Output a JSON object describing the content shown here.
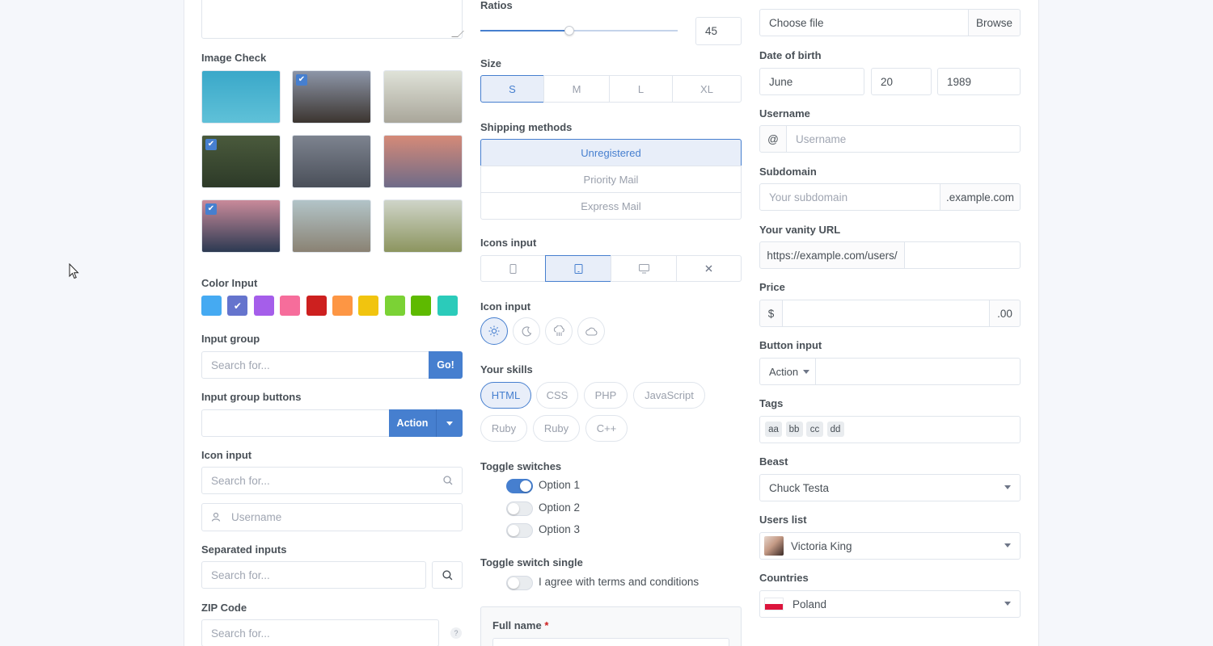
{
  "col1": {
    "image_check": {
      "label": "Image Check",
      "images": [
        {
          "name": "island-image",
          "checked": false,
          "colors": [
            "#3aa8c9",
            "#5fc1d8"
          ]
        },
        {
          "name": "mountain-girls-image",
          "checked": true,
          "colors": [
            "#8d96a8",
            "#3c3530"
          ]
        },
        {
          "name": "bmx-image",
          "checked": false,
          "colors": [
            "#dfe2d8",
            "#a9a69a"
          ]
        },
        {
          "name": "temple-image",
          "checked": true,
          "colors": [
            "#4a5a3c",
            "#2d3a28"
          ]
        },
        {
          "name": "lake-mountains-image",
          "checked": false,
          "colors": [
            "#7d838f",
            "#4a4f59"
          ]
        },
        {
          "name": "sunset-image",
          "checked": false,
          "colors": [
            "#d58a78",
            "#6f6b88"
          ]
        },
        {
          "name": "glacier-image",
          "checked": true,
          "colors": [
            "#c98a9a",
            "#2c3a52"
          ]
        },
        {
          "name": "calm-lake-image",
          "checked": false,
          "colors": [
            "#b2c4c8",
            "#8a8273"
          ]
        },
        {
          "name": "valley-image",
          "checked": false,
          "colors": [
            "#cfd5c9",
            "#8c955f"
          ]
        }
      ]
    },
    "color_input": {
      "label": "Color Input",
      "colors": [
        "#45aaf2",
        "#6574cd",
        "#a55eea",
        "#f66d9b",
        "#cd201f",
        "#fd9644",
        "#f1c40f",
        "#7bd235",
        "#5eba00",
        "#2bcbba"
      ],
      "selected_index": 1
    },
    "input_group": {
      "label": "Input group",
      "placeholder": "Search for...",
      "button": "Go!"
    },
    "input_group_buttons": {
      "label": "Input group buttons",
      "button": "Action"
    },
    "icon_input": {
      "label": "Icon input",
      "search_placeholder": "Search for...",
      "username_placeholder": "Username"
    },
    "separated_inputs": {
      "label": "Separated inputs",
      "placeholder": "Search for..."
    },
    "zip_code": {
      "label": "ZIP Code",
      "placeholder": "Search for...",
      "help": "?"
    }
  },
  "col2": {
    "ratios": {
      "label": "Ratios",
      "value": "45",
      "fraction": 0.45
    },
    "size": {
      "label": "Size",
      "options": [
        "S",
        "M",
        "L",
        "XL"
      ],
      "selected": 0
    },
    "shipping": {
      "label": "Shipping methods",
      "options": [
        "Unregistered",
        "Priority Mail",
        "Express Mail"
      ],
      "selected": 0
    },
    "icons_input": {
      "label": "Icons input",
      "options": [
        "phone-icon",
        "tablet-icon",
        "monitor-icon",
        "x-icon"
      ],
      "selected": 1
    },
    "icon_input": {
      "label": "Icon input",
      "options": [
        "sun-icon",
        "moon-icon",
        "cloud-rain-icon",
        "cloud-icon"
      ],
      "selected": 0
    },
    "skills": {
      "label": "Your skills",
      "row1": [
        "HTML",
        "CSS",
        "PHP",
        "JavaScript"
      ],
      "row2": [
        "Ruby",
        "Ruby",
        "C++"
      ],
      "selected": 0
    },
    "toggle_switches": {
      "label": "Toggle switches",
      "options": [
        {
          "label": "Option 1",
          "on": true
        },
        {
          "label": "Option 2",
          "on": false
        },
        {
          "label": "Option 3",
          "on": false
        }
      ]
    },
    "toggle_single": {
      "label": "Toggle switch single",
      "text": "I agree with terms and conditions"
    },
    "full_name": {
      "label": "Full name",
      "required": "*"
    }
  },
  "col3": {
    "file_input": {
      "placeholder": "Choose file",
      "button": "Browse"
    },
    "dob": {
      "label": "Date of birth",
      "month": "June",
      "day": "20",
      "year": "1989"
    },
    "username": {
      "label": "Username",
      "addon": "@",
      "placeholder": "Username"
    },
    "subdomain": {
      "label": "Subdomain",
      "placeholder": "Your subdomain",
      "addon": ".example.com"
    },
    "vanity": {
      "label": "Your vanity URL",
      "addon": "https://example.com/users/"
    },
    "price": {
      "label": "Price",
      "prefix": "$",
      "suffix": ".00"
    },
    "button_input": {
      "label": "Button input",
      "button": "Action"
    },
    "tags": {
      "label": "Tags",
      "items": [
        "aa",
        "bb",
        "cc",
        "dd"
      ]
    },
    "beast": {
      "label": "Beast",
      "value": "Chuck Testa"
    },
    "users_list": {
      "label": "Users list",
      "value": "Victoria King"
    },
    "countries": {
      "label": "Countries",
      "value": "Poland"
    }
  },
  "colors": {
    "primary": "#467fcf",
    "border": "#e0e5ec"
  }
}
